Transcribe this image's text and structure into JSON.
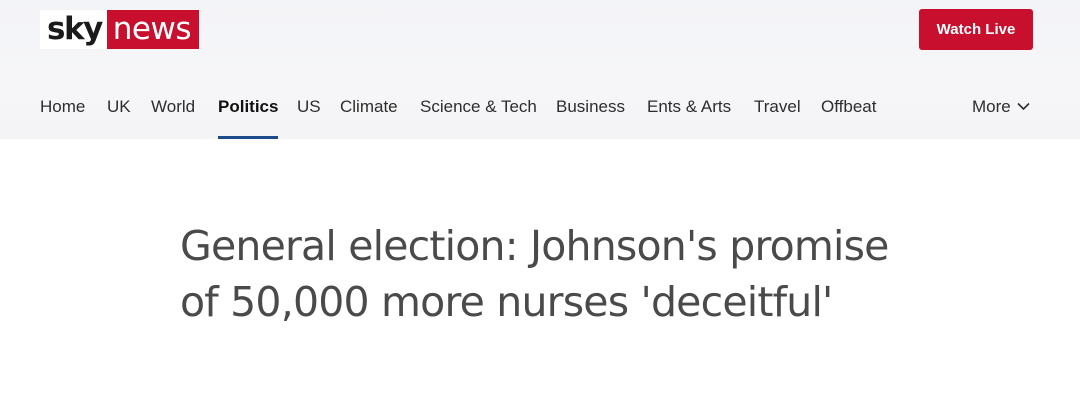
{
  "brand": {
    "sky": "sky",
    "news": "news",
    "accent": "#c8102e"
  },
  "header": {
    "watch_live_label": "Watch Live"
  },
  "nav": {
    "items": [
      {
        "label": "Home"
      },
      {
        "label": "UK"
      },
      {
        "label": "World"
      },
      {
        "label": "Politics",
        "active": true
      },
      {
        "label": "US"
      },
      {
        "label": "Climate"
      },
      {
        "label": "Science & Tech"
      },
      {
        "label": "Business"
      },
      {
        "label": "Ents & Arts"
      },
      {
        "label": "Travel"
      },
      {
        "label": "Offbeat"
      }
    ],
    "more_label": "More",
    "more_icon": "chevron-down-icon",
    "active_underline_color": "#1c4b8b"
  },
  "article": {
    "headline": "General election: Johnson's promise of 50,000 more nurses 'deceitful'"
  }
}
